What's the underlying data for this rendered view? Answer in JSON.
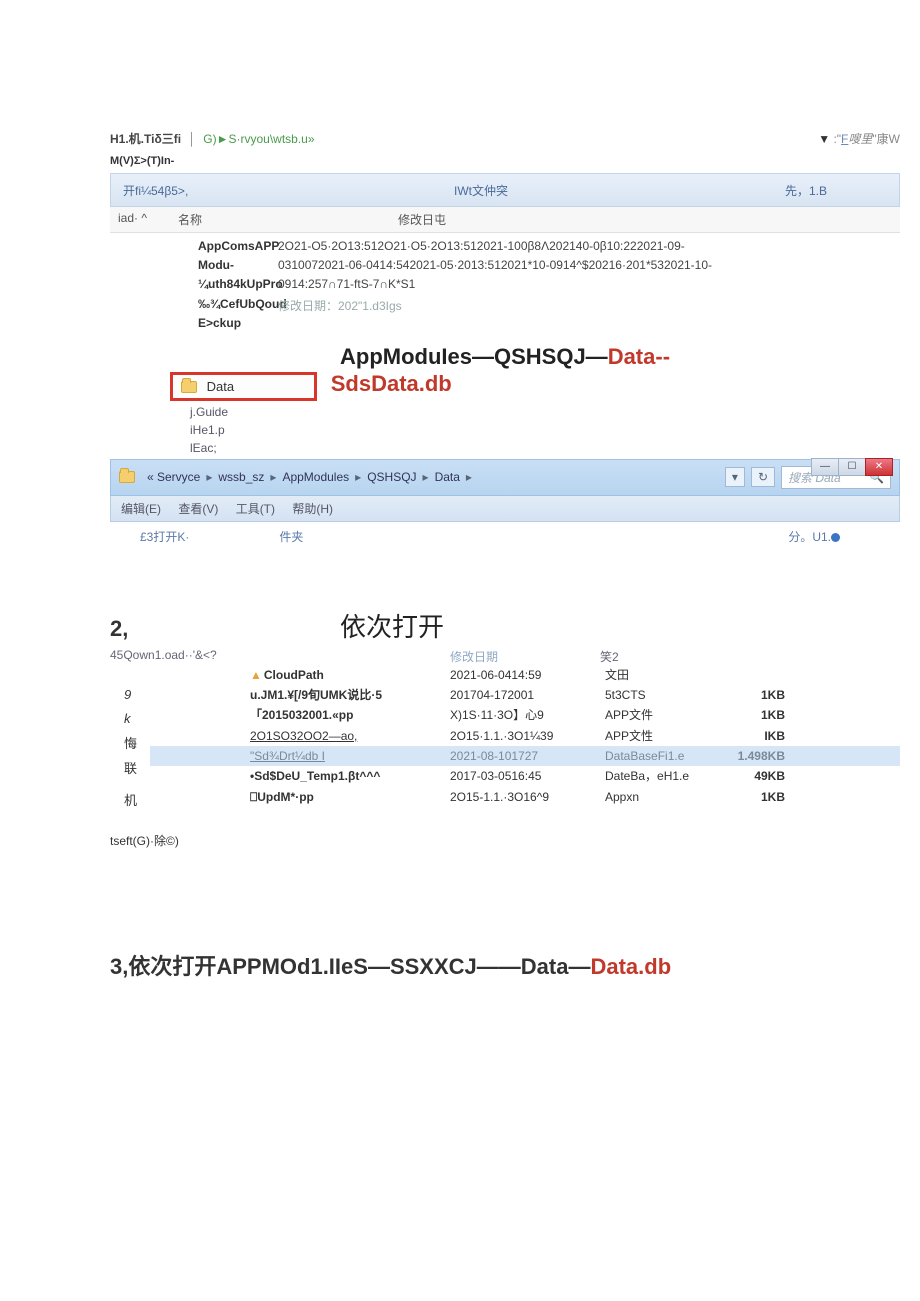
{
  "header": {
    "line1_a": "H1.机.Tiδ三fi",
    "line1_b": "G)►S·rvyou\\wtsb.u»",
    "search_tri": "▼",
    "search_pre": ":\"",
    "search_u": "F",
    "search_it": "嗖里",
    "search_suf": "\"康W",
    "menu": "M(V)Σ>(T)In-"
  },
  "toolbar": {
    "left": "开fi¼54β5>,",
    "mid": "IWt文仲突",
    "right": "先，1.B"
  },
  "cols1": {
    "c1": "iad· ^",
    "c2": "名称",
    "c3": "修改日屯"
  },
  "list1": {
    "names": [
      "AppComsAPP",
      "Modu-",
      "¼uth84kUpPro",
      "‰¾CefUbQoud",
      "E>ckup"
    ],
    "dates_l1": "2O21-O5·2O13:512O21·O5·2O13:512021-100β8Λ202140-0β10:222021-09-",
    "dates_l2": "0310072021-06-0414:542021-05·2013:512021*10-0914^$20216·201*532021-10-",
    "dates_l3": "0914:257∩71-ftS-7∩K*S1",
    "mod_label": "修改日期：202\"1.d3Igs"
  },
  "annot1": {
    "p1": "AppModuIes—QSHSQJ—",
    "p2": "Data--",
    "p3": "SdsData.db"
  },
  "folder": {
    "label": "Data"
  },
  "sublist": {
    "l1": "j.Guide",
    "l2": "iHe1.p",
    "l3": "lEac;"
  },
  "crumb": {
    "s0": "« Servyce",
    "s1": "wssb_sz",
    "s2": "AppModules",
    "s3": "QSHSQJ",
    "s4": "Data",
    "arrow": "▸",
    "dd": "▾",
    "refresh": "↻",
    "search_ph": "搜索 Data",
    "mag": "🔍"
  },
  "wbtn": {
    "min": "—",
    "max": "☐",
    "close": "✕"
  },
  "menus2": {
    "m1": "编辑(E)",
    "m2": "查看(V)",
    "m3": "工具(T)",
    "m4": "帮助(H)"
  },
  "status2": {
    "left": "£3打开K·",
    "mid": "件夹",
    "right": "分。U1."
  },
  "s2": {
    "num": "2,",
    "title": "依次打开",
    "sub": "45Qown1.oad··'&<?",
    "h2": "修改日期",
    "h3": "笑2",
    "side": [
      "9",
      "k",
      "悔",
      "联",
      "机"
    ],
    "rows": [
      {
        "n": "CloudPath",
        "d": "2021-06-0414:59",
        "t": "文田",
        "s": "",
        "caret": true,
        "bold": true
      },
      {
        "n": "u.JM1.¥[/9旬UMK说比·5",
        "d": "201704-172001",
        "t": "5t3CTS",
        "s": "1KB",
        "bold": true
      },
      {
        "n": "「2015032001.«pp",
        "d": "X)1S·11·3O】心9",
        "t": "APP文件",
        "s": "1KB",
        "bold": true
      },
      {
        "n": "2O1SO32OO2—ao,",
        "d": "2O15·1.1.·3O1¼39",
        "t": "APP文性",
        "s": "IKB",
        "ul": true
      },
      {
        "n": "\"Sd¾Drt¼db                    I",
        "d": "2021-08-101727",
        "t": "DataBaseFi1.e",
        "s": "1.498KB",
        "sel": true
      },
      {
        "n": "•Sd$DeU_Temp1.βt^^^",
        "d": "2017-03-0516:45",
        "t": "DateBa，eH1.e",
        "s": "49KB",
        "bold": true
      },
      {
        "n": "⎕UpdM*·pp",
        "d": "2O15-1.1.·3O16^9",
        "t": "Appxn",
        "s": "1KB",
        "bold": true
      }
    ],
    "tseft": "tseft(G)·除©)"
  },
  "s3": {
    "pre": "3,依次打开APPMOd1.IIeS—SSXXCJ——Data—",
    "red": "Data.db"
  }
}
